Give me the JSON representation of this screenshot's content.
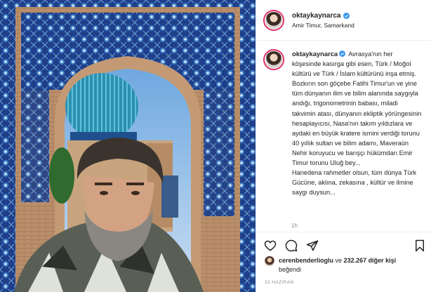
{
  "post": {
    "username": "oktaykaynarca",
    "location": "Amir Timur, Samarkand",
    "caption": "Avrasya'nın her köşesinde kasırga gibi esen, Türk / Moğol kültürü ve Türk / İslam kültürünü inşa etmiş. Bozkırın son göçebe Fatihi Timur'un ve yine tüm dünyanın ilim ve bilim alanında saygıyla andığı, trigonometrinin babası, miladi takvimin atası, dünyanın ekliptik yörüngesinin hesaplayıcısı, Nasa'nın takım yıldızlara ve aydaki en büyük kratere ismini verdiği torunu 40 yıllık sultan ve bilim adamı, Maveraün Nehir koruyucu ve barışçı hükümdarı Emir Timur torunu Uluğ bey...\nHanedena rahmetler olsun, tüm dünya Türk Gücüne, aklına, zekasına , kültür ve ilmine saygı duysun...",
    "time_ago": "1h",
    "likes": {
      "liker": "cerenbenderlioglu",
      "connector": "ve",
      "count": "232.267 diğer kişi",
      "suffix": "beğendi"
    },
    "date": "23 HAZİRAN"
  },
  "icons": {
    "verified": "verified-badge-icon",
    "like": "heart-icon",
    "comment": "comment-icon",
    "share": "paper-plane-icon",
    "save": "bookmark-icon"
  },
  "colors": {
    "verified": "#3897f0",
    "story_ring": "#e1306c",
    "muted_text": "#8e8e8e",
    "divider": "#efefef"
  }
}
